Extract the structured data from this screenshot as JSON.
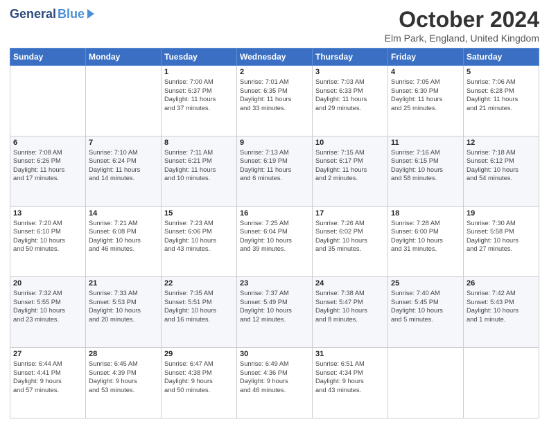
{
  "logo": {
    "general": "General",
    "blue": "Blue"
  },
  "title": "October 2024",
  "location": "Elm Park, England, United Kingdom",
  "days": [
    "Sunday",
    "Monday",
    "Tuesday",
    "Wednesday",
    "Thursday",
    "Friday",
    "Saturday"
  ],
  "weeks": [
    [
      {
        "day": "",
        "content": ""
      },
      {
        "day": "",
        "content": ""
      },
      {
        "day": "1",
        "content": "Sunrise: 7:00 AM\nSunset: 6:37 PM\nDaylight: 11 hours\nand 37 minutes."
      },
      {
        "day": "2",
        "content": "Sunrise: 7:01 AM\nSunset: 6:35 PM\nDaylight: 11 hours\nand 33 minutes."
      },
      {
        "day": "3",
        "content": "Sunrise: 7:03 AM\nSunset: 6:33 PM\nDaylight: 11 hours\nand 29 minutes."
      },
      {
        "day": "4",
        "content": "Sunrise: 7:05 AM\nSunset: 6:30 PM\nDaylight: 11 hours\nand 25 minutes."
      },
      {
        "day": "5",
        "content": "Sunrise: 7:06 AM\nSunset: 6:28 PM\nDaylight: 11 hours\nand 21 minutes."
      }
    ],
    [
      {
        "day": "6",
        "content": "Sunrise: 7:08 AM\nSunset: 6:26 PM\nDaylight: 11 hours\nand 17 minutes."
      },
      {
        "day": "7",
        "content": "Sunrise: 7:10 AM\nSunset: 6:24 PM\nDaylight: 11 hours\nand 14 minutes."
      },
      {
        "day": "8",
        "content": "Sunrise: 7:11 AM\nSunset: 6:21 PM\nDaylight: 11 hours\nand 10 minutes."
      },
      {
        "day": "9",
        "content": "Sunrise: 7:13 AM\nSunset: 6:19 PM\nDaylight: 11 hours\nand 6 minutes."
      },
      {
        "day": "10",
        "content": "Sunrise: 7:15 AM\nSunset: 6:17 PM\nDaylight: 11 hours\nand 2 minutes."
      },
      {
        "day": "11",
        "content": "Sunrise: 7:16 AM\nSunset: 6:15 PM\nDaylight: 10 hours\nand 58 minutes."
      },
      {
        "day": "12",
        "content": "Sunrise: 7:18 AM\nSunset: 6:12 PM\nDaylight: 10 hours\nand 54 minutes."
      }
    ],
    [
      {
        "day": "13",
        "content": "Sunrise: 7:20 AM\nSunset: 6:10 PM\nDaylight: 10 hours\nand 50 minutes."
      },
      {
        "day": "14",
        "content": "Sunrise: 7:21 AM\nSunset: 6:08 PM\nDaylight: 10 hours\nand 46 minutes."
      },
      {
        "day": "15",
        "content": "Sunrise: 7:23 AM\nSunset: 6:06 PM\nDaylight: 10 hours\nand 43 minutes."
      },
      {
        "day": "16",
        "content": "Sunrise: 7:25 AM\nSunset: 6:04 PM\nDaylight: 10 hours\nand 39 minutes."
      },
      {
        "day": "17",
        "content": "Sunrise: 7:26 AM\nSunset: 6:02 PM\nDaylight: 10 hours\nand 35 minutes."
      },
      {
        "day": "18",
        "content": "Sunrise: 7:28 AM\nSunset: 6:00 PM\nDaylight: 10 hours\nand 31 minutes."
      },
      {
        "day": "19",
        "content": "Sunrise: 7:30 AM\nSunset: 5:58 PM\nDaylight: 10 hours\nand 27 minutes."
      }
    ],
    [
      {
        "day": "20",
        "content": "Sunrise: 7:32 AM\nSunset: 5:55 PM\nDaylight: 10 hours\nand 23 minutes."
      },
      {
        "day": "21",
        "content": "Sunrise: 7:33 AM\nSunset: 5:53 PM\nDaylight: 10 hours\nand 20 minutes."
      },
      {
        "day": "22",
        "content": "Sunrise: 7:35 AM\nSunset: 5:51 PM\nDaylight: 10 hours\nand 16 minutes."
      },
      {
        "day": "23",
        "content": "Sunrise: 7:37 AM\nSunset: 5:49 PM\nDaylight: 10 hours\nand 12 minutes."
      },
      {
        "day": "24",
        "content": "Sunrise: 7:38 AM\nSunset: 5:47 PM\nDaylight: 10 hours\nand 8 minutes."
      },
      {
        "day": "25",
        "content": "Sunrise: 7:40 AM\nSunset: 5:45 PM\nDaylight: 10 hours\nand 5 minutes."
      },
      {
        "day": "26",
        "content": "Sunrise: 7:42 AM\nSunset: 5:43 PM\nDaylight: 10 hours\nand 1 minute."
      }
    ],
    [
      {
        "day": "27",
        "content": "Sunrise: 6:44 AM\nSunset: 4:41 PM\nDaylight: 9 hours\nand 57 minutes."
      },
      {
        "day": "28",
        "content": "Sunrise: 6:45 AM\nSunset: 4:39 PM\nDaylight: 9 hours\nand 53 minutes."
      },
      {
        "day": "29",
        "content": "Sunrise: 6:47 AM\nSunset: 4:38 PM\nDaylight: 9 hours\nand 50 minutes."
      },
      {
        "day": "30",
        "content": "Sunrise: 6:49 AM\nSunset: 4:36 PM\nDaylight: 9 hours\nand 46 minutes."
      },
      {
        "day": "31",
        "content": "Sunrise: 6:51 AM\nSunset: 4:34 PM\nDaylight: 9 hours\nand 43 minutes."
      },
      {
        "day": "",
        "content": ""
      },
      {
        "day": "",
        "content": ""
      }
    ]
  ]
}
